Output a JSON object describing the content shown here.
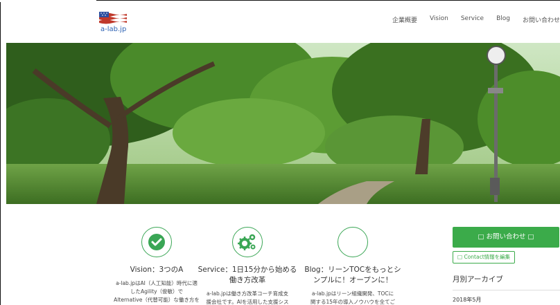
{
  "site": {
    "logo_text": "a-lab.jp"
  },
  "nav": {
    "items": [
      "企業概要",
      "Vision",
      "Service",
      "Blog",
      "お問い合わせ"
    ]
  },
  "features": [
    {
      "icon": "check-icon",
      "title": "Vision：3つのA",
      "desc_lines": [
        "a-lab.jpはAI（人工知能）時代に適",
        "したAgility（俊敏）で",
        "Alternative（代替可能）な働き方を"
      ]
    },
    {
      "icon": "gears-icon",
      "title": "Service：1日15分から始める働き方改革",
      "desc_lines": [
        "a-lab.jpは働き方改革コーチ育成支",
        "援会社です。AIを活用した支援シス"
      ]
    },
    {
      "icon": "none",
      "title": "Blog：リーンTOCをもっとシンプルに！オープンに！",
      "desc_lines": [
        "a-lab.jpはリーン組織開発、TOCに",
        "関する15年の導入ノウハウを全てご"
      ]
    }
  ],
  "sidebar": {
    "contact_label": "□ お問い合わせ □",
    "edit_label": "□ Contact情報を編集",
    "archive_title": "月別アーカイブ",
    "archive_items": [
      "2018年5月"
    ]
  },
  "colors": {
    "accent": "#3bab4a",
    "link": "#2d62b3"
  }
}
